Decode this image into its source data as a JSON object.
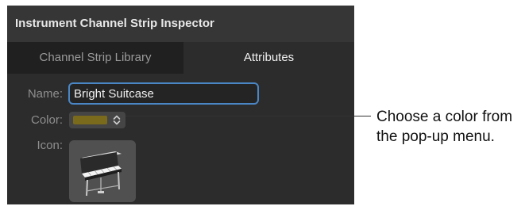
{
  "inspector": {
    "title": "Instrument Channel Strip Inspector",
    "tabs": [
      {
        "label": "Channel Strip Library",
        "selected": false
      },
      {
        "label": "Attributes",
        "selected": true
      }
    ],
    "name_label": "Name:",
    "name_value": "Bright Suitcase",
    "color_label": "Color:",
    "color_value": "#7a6a1c",
    "icon_label": "Icon:",
    "icon_name": "electric-piano-icon"
  },
  "callout": {
    "text": "Choose a color from the pop-up menu."
  }
}
